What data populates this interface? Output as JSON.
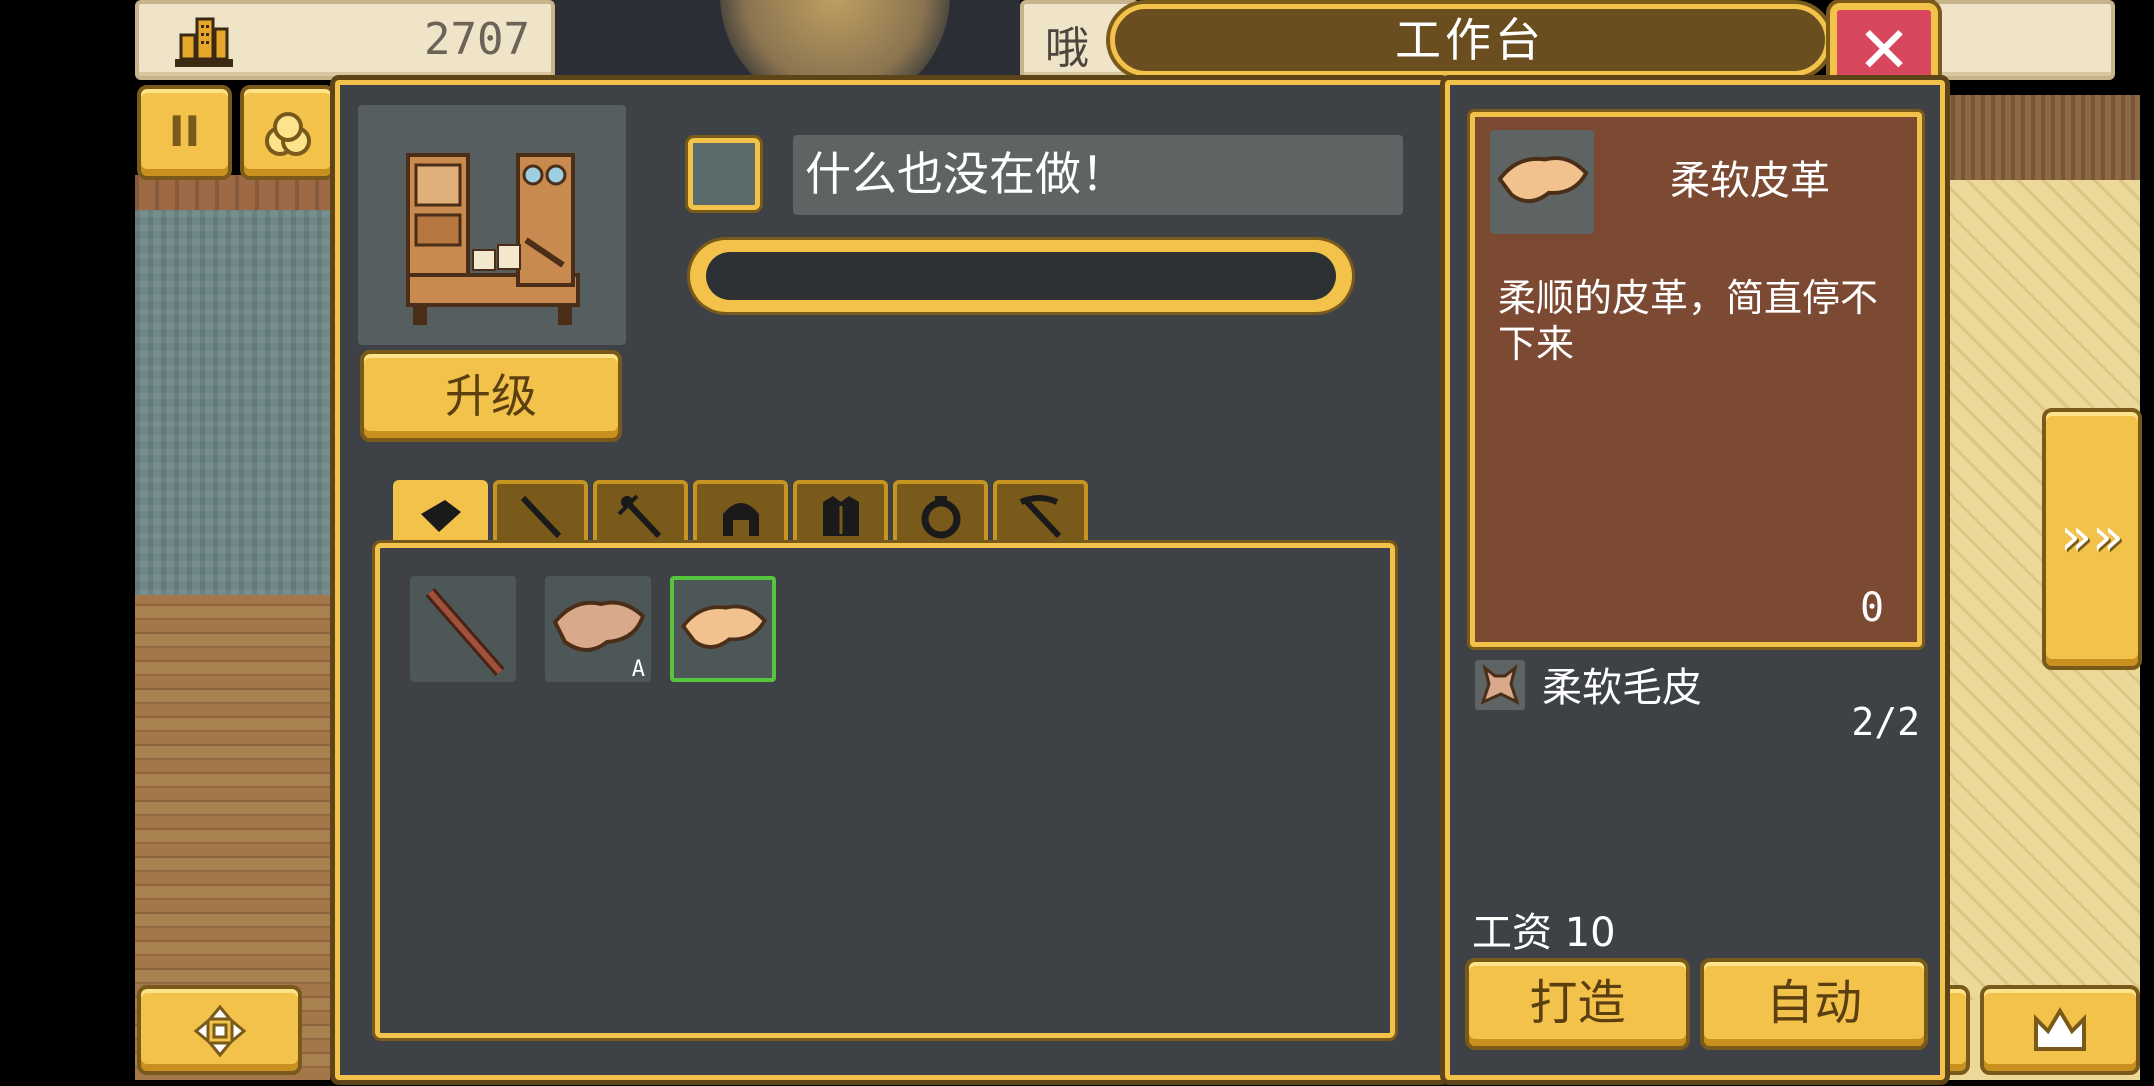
{
  "top_bar": {
    "money": "2707",
    "partial_text": "哦",
    "title": "工作台",
    "close_glyph": "✕"
  },
  "left_buttons": {
    "pause_glyph": "II",
    "coins_glyph": "⦿"
  },
  "workbench": {
    "status_text": "什么也没在做！",
    "upgrade_label": "升级",
    "progress": 0
  },
  "tabs": [
    {
      "icon": "leather-icon"
    },
    {
      "icon": "stick-icon"
    },
    {
      "icon": "staff-icon"
    },
    {
      "icon": "helmet-icon"
    },
    {
      "icon": "armor-icon"
    },
    {
      "icon": "ring-icon"
    },
    {
      "icon": "pickaxe-icon"
    }
  ],
  "items": [
    {
      "icon": "wooden-stick-icon"
    },
    {
      "icon": "leather-icon",
      "badge": "A"
    },
    {
      "icon": "soft-leather-icon",
      "selected": true
    }
  ],
  "detail": {
    "name": "柔软皮革",
    "description": "柔顺的皮革，简直停不下来",
    "count": "0",
    "material_name": "柔软毛皮",
    "material_count": "2/2",
    "wage": "工资 10",
    "craft_label": "打造",
    "auto_label": "自动"
  },
  "colors": {
    "gold": "#f3c24a",
    "panel": "#3e4247",
    "detail_card": "#7c4a33",
    "close_red": "#d8475e",
    "select_green": "#57c53b"
  }
}
